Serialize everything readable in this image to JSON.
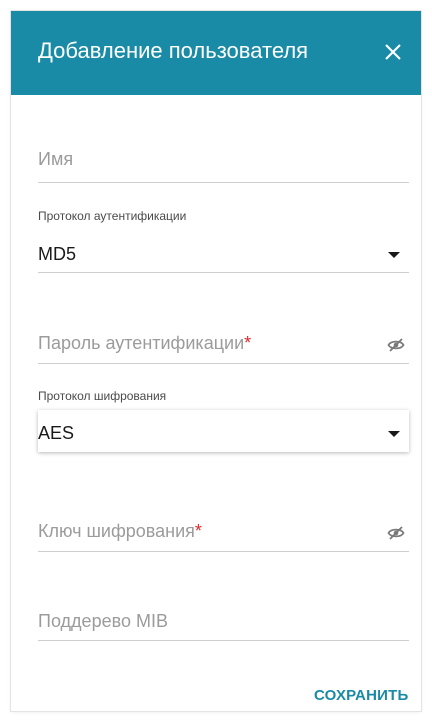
{
  "dialog": {
    "title": "Добавление пользователя",
    "close_icon": "close-icon",
    "header_color": "#1a8ba6"
  },
  "form": {
    "name": {
      "placeholder": "Имя",
      "value": ""
    },
    "auth_protocol": {
      "label": "Протокол аутентификации",
      "value": "MD5"
    },
    "auth_password": {
      "placeholder": "Пароль аутентификации",
      "required_mark": "*",
      "icon": "eye-slash-icon"
    },
    "priv_protocol": {
      "label": "Протокол шифрования",
      "value": "AES"
    },
    "priv_key": {
      "placeholder": "Ключ шифрования",
      "required_mark": "*",
      "icon": "eye-slash-icon"
    },
    "mib_subtree": {
      "placeholder": "Поддерево MIB",
      "value": ""
    }
  },
  "actions": {
    "save_label": "СОХРАНИТЬ"
  },
  "colors": {
    "accent": "#1a8ba6",
    "required": "#e0262b"
  }
}
